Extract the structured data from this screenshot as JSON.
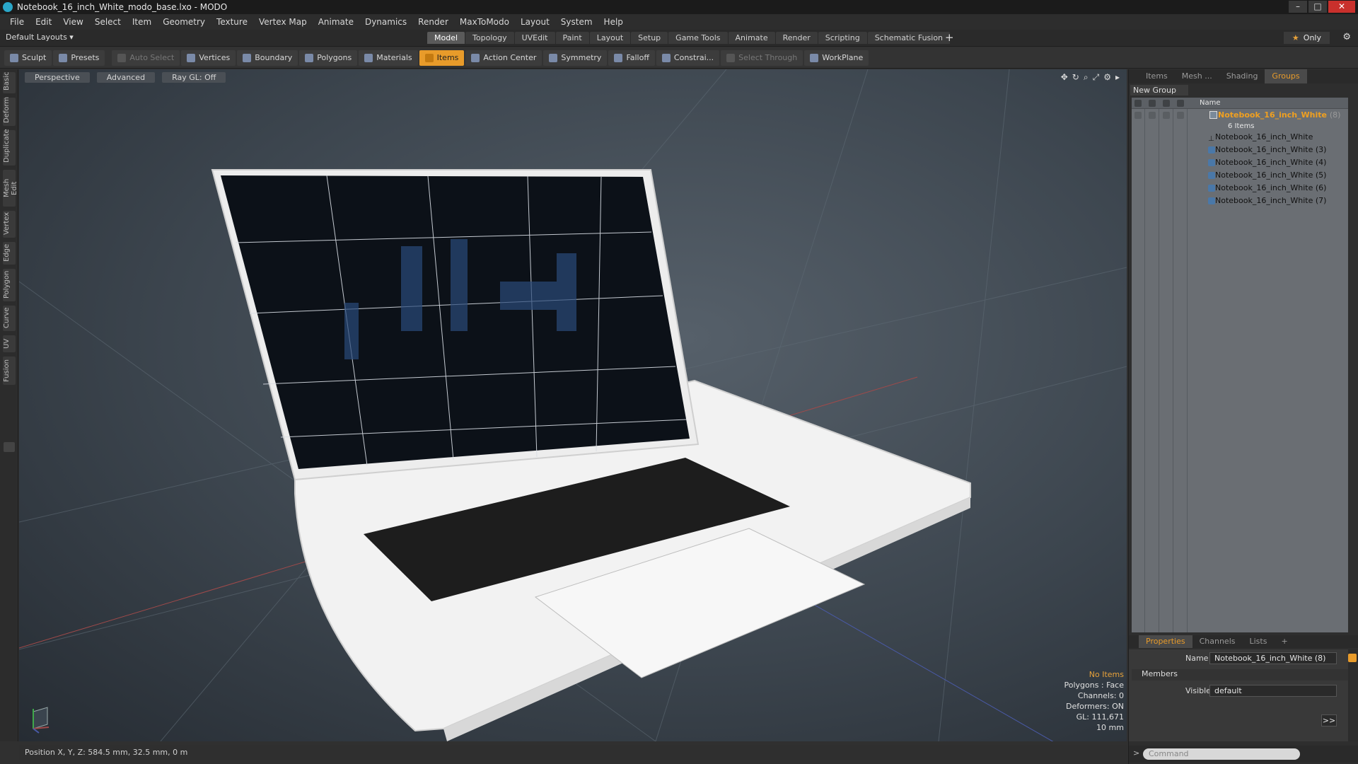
{
  "window": {
    "title": "Notebook_16_inch_White_modo_base.lxo - MODO",
    "min": "–",
    "max": "□",
    "close": "✕"
  },
  "menu": [
    "File",
    "Edit",
    "View",
    "Select",
    "Item",
    "Geometry",
    "Texture",
    "Vertex Map",
    "Animate",
    "Dynamics",
    "Render",
    "MaxToModo",
    "Layout",
    "System",
    "Help"
  ],
  "layouts": {
    "selector": "Default Layouts ▾",
    "tabs": [
      "Model",
      "Topology",
      "UVEdit",
      "Paint",
      "Layout",
      "Setup",
      "Game Tools",
      "Animate",
      "Render",
      "Scripting",
      "Schematic Fusion"
    ],
    "active_tab": "Model",
    "plus": "+",
    "only_star": "★",
    "only_label": "Only",
    "gear": "⚙"
  },
  "toolbar": {
    "sculpt": "Sculpt",
    "presets": "Presets",
    "auto_select": "Auto Select",
    "vertices": "Vertices",
    "boundary": "Boundary",
    "polygons": "Polygons",
    "materials": "Materials",
    "items": "Items",
    "action_center": "Action Center",
    "symmetry": "Symmetry",
    "falloff": "Falloff",
    "constraints": "Constrai...",
    "select_through": "Select Through",
    "workplane": "WorkPlane"
  },
  "left_tabs": [
    "Basic",
    "Deform",
    "Duplicate",
    "Mesh Edit",
    "Vertex",
    "Edge",
    "Polygon",
    "Curve",
    "UV",
    "Fusion"
  ],
  "viewport": {
    "perspective": "Perspective",
    "advanced": "Advanced",
    "raygl": "Ray GL: Off",
    "icons": [
      "✥",
      "↻",
      "⌕",
      "⤢",
      "⚙",
      "▸"
    ],
    "stats": {
      "no_items": "No Items",
      "polygons": "Polygons : Face",
      "channels": "Channels: 0",
      "deformers": "Deformers: ON",
      "gl": "GL: 111,671",
      "scale": "10 mm"
    }
  },
  "status": {
    "position": "Position X, Y, Z:   584.5 mm, 32.5 mm, 0 m"
  },
  "right_panel": {
    "tabs": [
      "Items",
      "Mesh ...",
      "Shading",
      "Groups"
    ],
    "active_tab": "Groups",
    "new_group": "New Group",
    "column_name": "Name",
    "group": {
      "name": "Notebook_16_inch_White",
      "suffix": "(8)",
      "count": "6 Items"
    },
    "items": [
      "Notebook_16_inch_White",
      "Notebook_16_inch_White (3)",
      "Notebook_16_inch_White (4)",
      "Notebook_16_inch_White (5)",
      "Notebook_16_inch_White (6)",
      "Notebook_16_inch_White (7)"
    ],
    "prop_tabs": [
      "Properties",
      "Channels",
      "Lists",
      "+"
    ],
    "props": {
      "name_label": "Name",
      "name_value": "Notebook_16_inch_White (8)",
      "members": "Members",
      "visible_label": "Visible",
      "visible_value": "default",
      "more": ">>"
    },
    "command_placeholder": "Command",
    "cmd_prompt": ">"
  },
  "colors": {
    "accent": "#e89b2a",
    "group_text": "#f0a020",
    "viewport_bg": "#3c454e"
  }
}
